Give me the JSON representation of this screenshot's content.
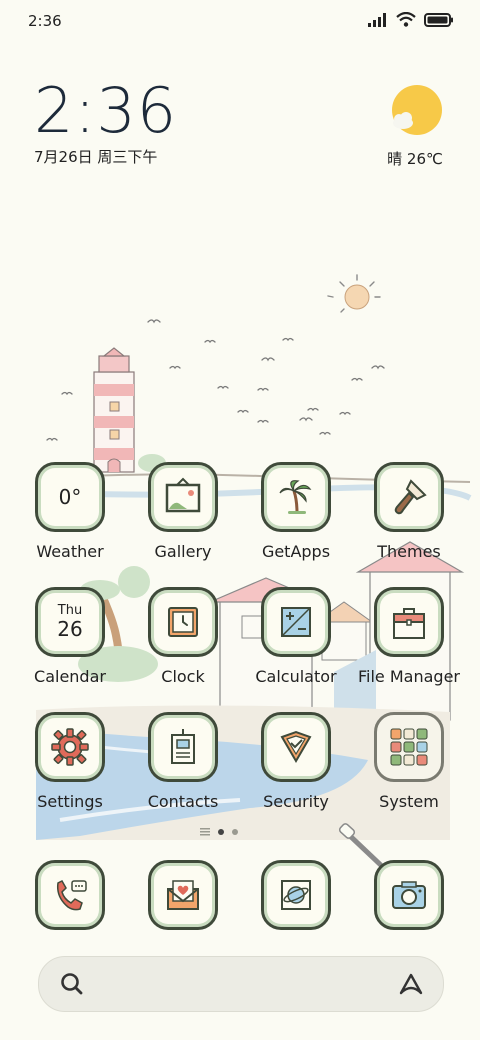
{
  "status_bar": {
    "time": "2:36",
    "icons": [
      "signal-icon",
      "wifi-icon",
      "battery-icon"
    ]
  },
  "clock_widget": {
    "time": "2:36",
    "date": "7月26日 周三下午"
  },
  "weather_widget": {
    "condition_icon": "sun-cloud-icon",
    "text": "晴 26℃"
  },
  "apps": [
    {
      "name": "Weather",
      "icon": "weather-icon",
      "tile_text": "0°"
    },
    {
      "name": "Gallery",
      "icon": "gallery-icon"
    },
    {
      "name": "GetApps",
      "icon": "palm-tree-icon"
    },
    {
      "name": "Themes",
      "icon": "paintbrush-icon"
    },
    {
      "name": "Calendar",
      "icon": "calendar-icon",
      "tile_day": "Thu",
      "tile_date": "26"
    },
    {
      "name": "Clock",
      "icon": "clock-icon"
    },
    {
      "name": "Calculator",
      "icon": "calculator-icon"
    },
    {
      "name": "File Manager",
      "icon": "folder-icon"
    },
    {
      "name": "Settings",
      "icon": "gear-icon"
    },
    {
      "name": "Contacts",
      "icon": "contact-card-icon"
    },
    {
      "name": "Security",
      "icon": "shield-icon"
    },
    {
      "name": "System",
      "icon": "folder-grid-icon"
    }
  ],
  "dock": [
    {
      "icon": "phone-icon"
    },
    {
      "icon": "mail-icon"
    },
    {
      "icon": "browser-icon"
    },
    {
      "icon": "camera-icon"
    }
  ],
  "page_indicator": {
    "pages": 2,
    "current": 1
  },
  "search": {
    "icons": [
      "search-icon",
      "assistant-icon"
    ]
  },
  "colors": {
    "background": "#fbfbf3",
    "tile_border": "#3f4a3a",
    "tile_inner": "#c9dcc0",
    "sun": "#f7c948",
    "sea": "#bcd6ea"
  }
}
